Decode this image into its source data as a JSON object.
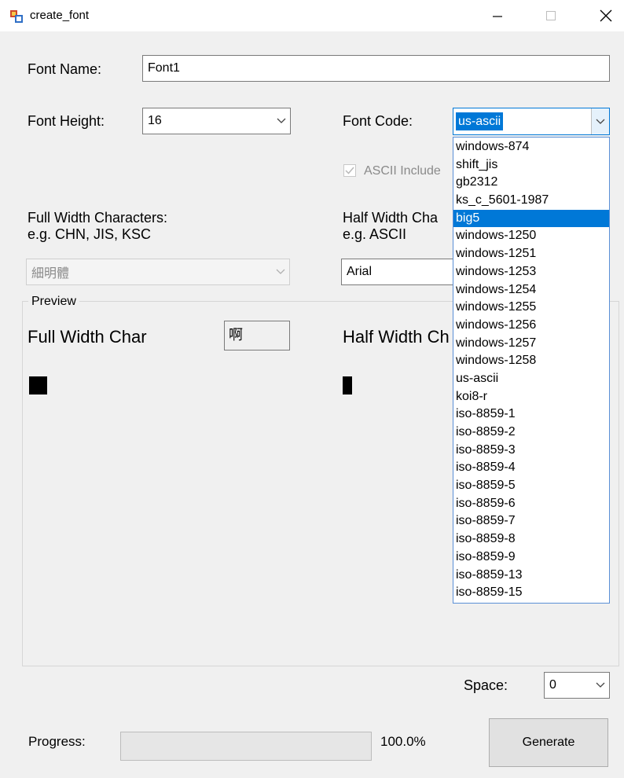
{
  "window": {
    "title": "create_font"
  },
  "font_name": {
    "label": "Font Name:",
    "value": "Font1"
  },
  "font_height": {
    "label": "Font Height:",
    "value": "16"
  },
  "font_code": {
    "label": "Font Code:",
    "value": "us-ascii",
    "options": [
      "windows-874",
      "shift_jis",
      "gb2312",
      "ks_c_5601-1987",
      "big5",
      "windows-1250",
      "windows-1251",
      "windows-1253",
      "windows-1254",
      "windows-1255",
      "windows-1256",
      "windows-1257",
      "windows-1258",
      "us-ascii",
      "koi8-r",
      "iso-8859-1",
      "iso-8859-2",
      "iso-8859-3",
      "iso-8859-4",
      "iso-8859-5",
      "iso-8859-6",
      "iso-8859-7",
      "iso-8859-8",
      "iso-8859-9",
      "iso-8859-13",
      "iso-8859-15"
    ],
    "highlighted": "big5"
  },
  "ascii_include": {
    "label": "ASCII Include",
    "checked": true
  },
  "full_width": {
    "label_line1": "Full Width Characters:",
    "label_line2": "e.g. CHN, JIS, KSC",
    "font": "細明體"
  },
  "half_width": {
    "label_line1": "Half Width Cha",
    "label_line2": "e.g. ASCII",
    "font": "Arial"
  },
  "preview": {
    "title": "Preview",
    "full_label": "Full Width Char",
    "full_sample": "啊",
    "half_label": "Half Width Ch"
  },
  "space": {
    "label": "Space:",
    "value": "0"
  },
  "progress": {
    "label": "Progress:",
    "value": 100.0,
    "text": "100.0%"
  },
  "generate_label": "Generate",
  "colors": {
    "highlight": "#0078d7",
    "border": "#7a7a7a",
    "background": "#f0f0f0"
  }
}
